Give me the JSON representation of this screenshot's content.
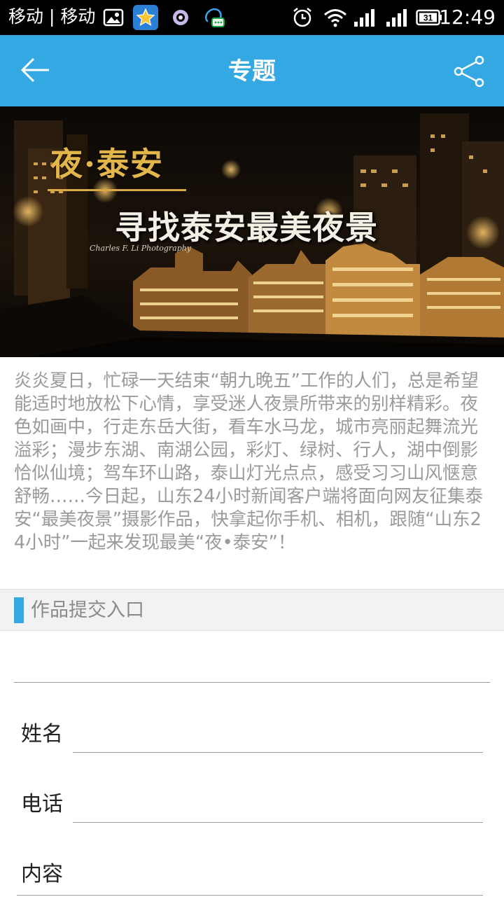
{
  "status_bar": {
    "carrier": "移动 | 移动",
    "time": "12:49",
    "battery_level": "31",
    "icons": [
      "gallery-icon",
      "star-app-icon",
      "app-ring-icon",
      "qq-icon",
      "alarm-icon",
      "wifi-icon",
      "signal-icon",
      "signal-icon",
      "battery-icon"
    ]
  },
  "header": {
    "title": "专题",
    "back_icon": "back-arrow-icon",
    "share_icon": "share-icon",
    "color": "#34a8e2"
  },
  "banner": {
    "logo": "夜·泰安",
    "headline": "寻找泰安最美夜景",
    "credit": "Charles F. Li Photography"
  },
  "intro": {
    "text": "炎炎夏日，忙碌一天结束“朝九晚五”工作的人们，总是希望能适时地放松下心情，享受迷人夜景所带来的别样精彩。夜色如画中，行走东岳大街，看车水马龙，城市亮丽起舞流光溢彩；漫步东湖、南湖公园，彩灯、绿树、行人，湖中倒影恰似仙境；驾车环山路，泰山灯光点点，感受习习山风惬意舒畅……今日起，山东24小时新闻客户端将面向网友征集泰安“最美夜景”摄影作品，快拿起你手机、相机，跟随“山东24小时”一起来发现最美“夜•泰安”！"
  },
  "section": {
    "title": "作品提交入口",
    "accent_color": "#34a8e2"
  },
  "form": {
    "name_label": "姓名",
    "phone_label": "电话",
    "content_label": "内容",
    "name_value": "",
    "phone_value": "",
    "content_value": ""
  }
}
